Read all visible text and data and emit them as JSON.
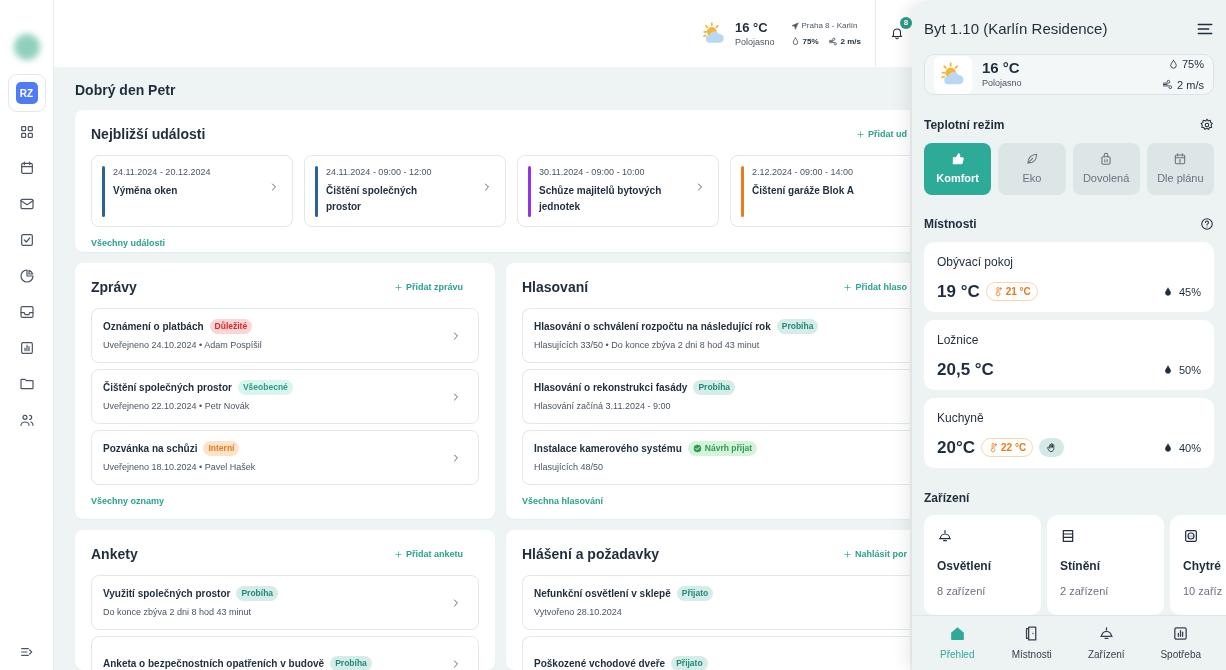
{
  "sidebar": {
    "avatar": "RZ"
  },
  "topbar": {
    "temperature": "16 °C",
    "condition": "Polojasno",
    "location": "Praha 8 - Karlín",
    "humidity": "75%",
    "wind": "2 m/s",
    "notifications": "8"
  },
  "greeting": "Dobrý den Petr",
  "events": {
    "title": "Nejbližší události",
    "add_link": "Přidat ud",
    "all_link": "Všechny události",
    "items": [
      {
        "date": "24.11.2024 - 20.12.2024",
        "title": "Výměna oken",
        "color": "#2a6496"
      },
      {
        "date": "24.11.2024 - 09:00 - 12:00",
        "title": "Čištění společných prostor",
        "color": "#2a6496"
      },
      {
        "date": "30.11.2024 - 09:00 - 10:00",
        "title": "Schůze majitelů bytových jednotek",
        "color": "#9333ea"
      },
      {
        "date": "2.12.2024 - 09:00 - 14:00",
        "title": "Čištení garáže Blok A",
        "color": "#ea7a1a"
      }
    ]
  },
  "messages": {
    "title": "Zprávy",
    "add_link": "Přidat  zprávu",
    "all_link": "Všechny oznamy",
    "items": [
      {
        "title": "Oznámení o platbách",
        "badge": {
          "text": "Důležité",
          "kind": "important"
        },
        "meta": "Uveřejneno 24.10.2024 • Adam Pospíšil"
      },
      {
        "title": "Čištění společných prostor",
        "badge": {
          "text": "Všeobecné",
          "kind": "general"
        },
        "meta": "Uveřejneno 22.10.2024 • Petr Novák"
      },
      {
        "title": "Pozvánka na schůzi",
        "badge": {
          "text": "Interní",
          "kind": "internal"
        },
        "meta": "Uveřejneno 18.10.2024 • Pavel Hašek"
      }
    ]
  },
  "voting": {
    "title": "Hlasovaní",
    "add_link": "Přidat hlaso",
    "all_link": "Všechna hlasování",
    "items": [
      {
        "title": "Hlasování o schválení rozpočtu na následující rok",
        "badge": {
          "text": "Probíha",
          "kind": "active"
        },
        "meta": "Hlasujících 33/50 • Do konce zbýva 2 dni 8 hod 43 minut"
      },
      {
        "title": "Hlasování o rekonstrukci fasády",
        "badge": {
          "text": "Probíha",
          "kind": "active"
        },
        "meta": "Hlasování začíná 3.11.2024 - 9:00"
      },
      {
        "title": "Instalace kamerového systému",
        "badge": {
          "text": "Návrh přijat",
          "kind": "approved"
        },
        "meta": "Hlasujících 48/50"
      }
    ]
  },
  "polls": {
    "title": "Ankety",
    "add_link": "Přidat anketu",
    "items": [
      {
        "title": "Využití společných prostor",
        "badge": {
          "text": "Probíha",
          "kind": "active"
        },
        "meta": "Do konce zbýva 2 dni 8 hod 43 minut"
      },
      {
        "title": "Anketa o bezpečnostních opatřeních v budově",
        "badge": {
          "text": "Probíha",
          "kind": "active"
        }
      }
    ]
  },
  "reports": {
    "title": "Hlášení a požadavky",
    "add_link": "Nahlásit por",
    "items": [
      {
        "title": "Nefunkční osvětlení v sklepě",
        "badge": {
          "text": "Přijato",
          "kind": "active"
        },
        "meta": "Vytvořeno 28.10.2024"
      },
      {
        "title": "Poškozené vchodové dveře",
        "badge": {
          "text": "Přijato",
          "kind": "active"
        }
      }
    ]
  },
  "panel": {
    "title": "Byt 1.10 (Karlín Residence)",
    "weather": {
      "temperature": "16 °C",
      "condition": "Polojasno",
      "humidity": "75%",
      "wind": "2 m/s"
    },
    "mode_title": "Teplotní režim",
    "modes": [
      {
        "label": "Komfort",
        "selected": true
      },
      {
        "label": "Eko",
        "selected": false
      },
      {
        "label": "Dovolená",
        "selected": false
      },
      {
        "label": "Dle plánu",
        "selected": false
      }
    ],
    "rooms_title": "Místnosti",
    "rooms": [
      {
        "name": "Obývací pokoj",
        "temperature": "19 °C",
        "target": "21 °C",
        "manual": false,
        "humidity": "45%"
      },
      {
        "name": "Ložnice",
        "temperature": "20,5 °C",
        "manual": false,
        "humidity": "50%"
      },
      {
        "name": "Kuchyně",
        "temperature": "20°C",
        "target": "22 °C",
        "manual": true,
        "humidity": "40%"
      }
    ],
    "devices_title": "Zařízení",
    "devices": [
      {
        "name": "Osvětlení",
        "count": "8 zařízení"
      },
      {
        "name": "Stínění",
        "count": "2 zařízení"
      },
      {
        "name": "Chytré",
        "count": "10 zaříz"
      }
    ],
    "nav": [
      {
        "label": "Přehled",
        "selected": true
      },
      {
        "label": "Místnosti",
        "selected": false
      },
      {
        "label": "Zařízení",
        "selected": false
      },
      {
        "label": "Spotřeba",
        "selected": false
      }
    ]
  }
}
